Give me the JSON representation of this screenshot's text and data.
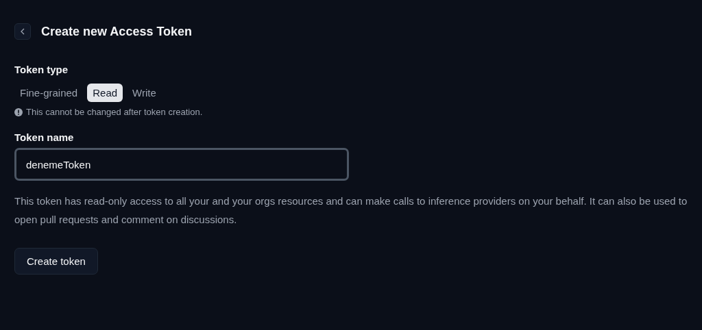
{
  "header": {
    "title": "Create new Access Token"
  },
  "token_type": {
    "label": "Token type",
    "tabs": [
      {
        "label": "Fine-grained",
        "selected": false
      },
      {
        "label": "Read",
        "selected": true
      },
      {
        "label": "Write",
        "selected": false
      }
    ],
    "note": "This cannot be changed after token creation."
  },
  "token_name": {
    "label": "Token name",
    "value": "denemeToken"
  },
  "description": "This token has read-only access to all your and your orgs resources and can make calls to inference providers on your behalf. It can also be used to open pull requests and comment on discussions.",
  "buttons": [
    "Create token"
  ]
}
